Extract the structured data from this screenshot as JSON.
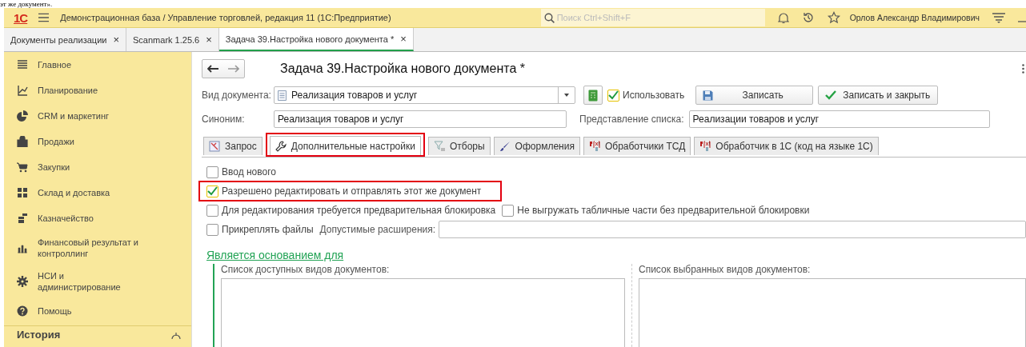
{
  "caption_fragment": "эт же документ».",
  "titlebar": {
    "logo": "1С",
    "title": "Демонстрационная база / Управление торговлей, редакция 11  (1С:Предприятие)",
    "search": {
      "placeholder": "Поиск Ctrl+Shift+F"
    },
    "user": "Орлов Александр Владимирович"
  },
  "open_tabs": [
    {
      "label": "Документы реализации",
      "close": "×",
      "selected": false
    },
    {
      "label": "Scanmark 1.25.6",
      "close": "×",
      "selected": false
    },
    {
      "label": "Задача 39.Настройка нового документа *",
      "close": "×",
      "selected": true
    }
  ],
  "sidebar": {
    "items": [
      {
        "label": "Главное"
      },
      {
        "label": "Планирование"
      },
      {
        "label": "CRM и маркетинг"
      },
      {
        "label": "Продажи"
      },
      {
        "label": "Закупки"
      },
      {
        "label": "Склад и доставка"
      },
      {
        "label": "Казначейство"
      },
      {
        "label": "Финансовый результат и контроллинг"
      },
      {
        "label": "НСИ и администрирование"
      },
      {
        "label": "Помощь"
      }
    ],
    "history": "История"
  },
  "form": {
    "title": "Задача 39.Настройка нового документа *",
    "doc_type": {
      "label": "Вид документа:",
      "value": "Реализация товаров и услуг"
    },
    "use": {
      "label": "Использовать",
      "checked": true
    },
    "buttons": [
      {
        "label": "Записать",
        "kind": "save"
      },
      {
        "label": "Записать и закрыть",
        "kind": "save-close"
      }
    ],
    "synonym": {
      "label": "Синоним:",
      "value": "Реализация товаров и услуг"
    },
    "list_view": {
      "label": "Представление списка:",
      "value": "Реализации товаров и услуг"
    },
    "tabs": [
      {
        "label": "Запрос",
        "selected": false,
        "highlighted": false
      },
      {
        "label": "Дополнительные настройки",
        "selected": true,
        "highlighted": true
      },
      {
        "label": "Отборы",
        "selected": false,
        "highlighted": false
      },
      {
        "label": "Оформления",
        "selected": false,
        "highlighted": false
      },
      {
        "label": "Обработчики ТСД",
        "selected": false,
        "highlighted": false
      },
      {
        "label": "Обработчик в 1С (код на языке 1С)",
        "selected": false,
        "highlighted": false
      }
    ],
    "option_rows": [
      [
        {
          "kind": "checkbox",
          "label": "Ввод нового",
          "checked": false,
          "highlighted": false
        }
      ],
      [
        {
          "kind": "checkbox",
          "label": "Разрешено редактировать и отправлять этот же документ",
          "checked": true,
          "highlighted": true
        }
      ],
      [
        {
          "kind": "checkbox",
          "label": "Для редактирования требуется предварительная блокировка",
          "checked": false,
          "highlighted": false
        },
        {
          "kind": "checkbox",
          "label": "Не выгружать табличные части без предварительной блокировки",
          "checked": false,
          "highlighted": false
        }
      ],
      [
        {
          "kind": "checkbox",
          "label": "Прикреплять файлы",
          "checked": false,
          "highlighted": false
        },
        {
          "kind": "field",
          "label": "Допустимые расширения:"
        }
      ]
    ],
    "basis": {
      "title": "Является основанием для",
      "available_label": "Список доступных видов документов:",
      "selected_label": "Список выбранных видов документов:"
    }
  }
}
